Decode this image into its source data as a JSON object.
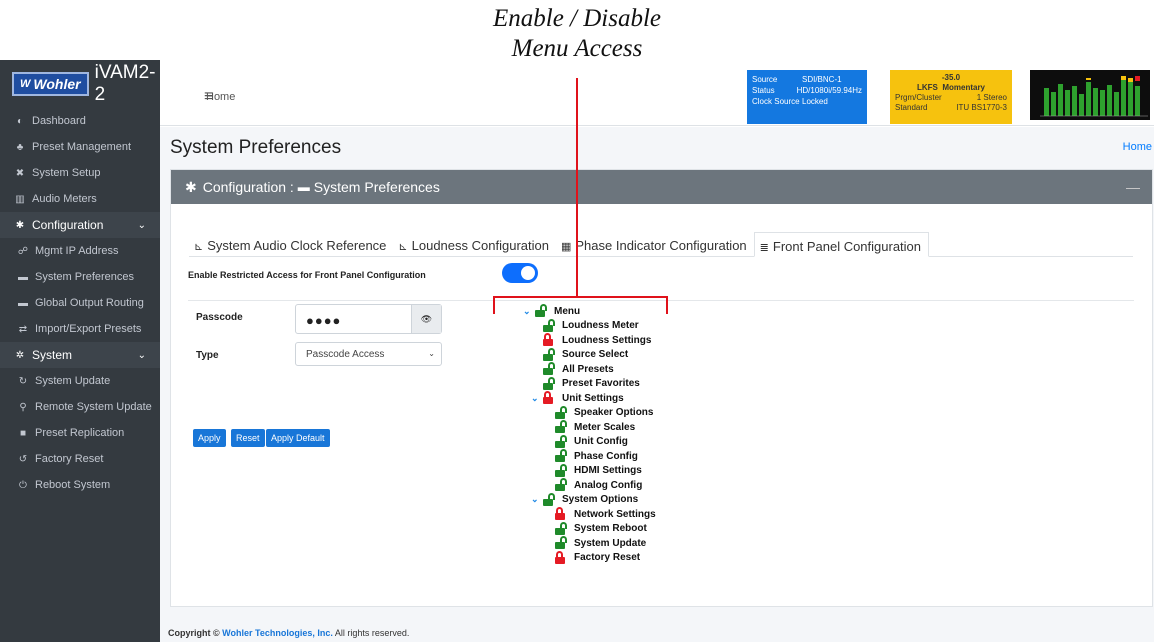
{
  "annotation": {
    "line1": "Enable / Disable",
    "line2": "Menu Access"
  },
  "brand": {
    "logo": "Wohler",
    "product": "iVAM2-2"
  },
  "sidebar": {
    "items": [
      {
        "label": "Dashboard",
        "icon": "dashboard-icon",
        "glyph": "◐"
      },
      {
        "label": "Preset Management",
        "icon": "users-icon",
        "glyph": "♣"
      },
      {
        "label": "System Setup",
        "icon": "tools-icon",
        "glyph": "✖"
      },
      {
        "label": "Audio Meters",
        "icon": "chart-icon",
        "glyph": "▥"
      },
      {
        "label": "Configuration",
        "icon": "gear-icon",
        "glyph": "✱",
        "group": true
      },
      {
        "label": "Mgmt IP Address",
        "icon": "network-icon",
        "glyph": "☍"
      },
      {
        "label": "System Preferences",
        "icon": "card-icon",
        "glyph": "▬"
      },
      {
        "label": "Global Output Routing",
        "icon": "card-icon",
        "glyph": "▬"
      },
      {
        "label": "Import/Export Presets",
        "icon": "exchange-icon",
        "glyph": "⇄"
      },
      {
        "label": "System",
        "icon": "cogs-icon",
        "glyph": "✲",
        "group": true
      },
      {
        "label": "System Update",
        "icon": "sync-icon",
        "glyph": "↻"
      },
      {
        "label": "Remote System Update",
        "icon": "satellite-icon",
        "glyph": "⚲"
      },
      {
        "label": "Preset Replication",
        "icon": "copy-icon",
        "glyph": "■"
      },
      {
        "label": "Factory Reset",
        "icon": "undo-icon",
        "glyph": "↺"
      },
      {
        "label": "Reboot System",
        "icon": "power-icon",
        "glyph": "⏻"
      }
    ]
  },
  "topbar": {
    "home": "Home"
  },
  "status": {
    "rows": [
      [
        "Source",
        "SDI/BNC-1"
      ],
      [
        "Status",
        "HD/1080i/59.94Hz"
      ],
      [
        "Clock Source",
        "Locked"
      ]
    ]
  },
  "lkfs": {
    "value": "-35.0",
    "lkfs": "LKFS",
    "mode": "Momentary",
    "prgm_label": "Prgm/Cluster",
    "prgm_value": "1  Stereo",
    "std_label": "Standard",
    "std_value": "ITU BS1770-3"
  },
  "page": {
    "title": "System Preferences",
    "breadcrumb": "Home"
  },
  "card": {
    "title": "Configuration : ",
    "subtitle": "System Preferences"
  },
  "tabs": [
    {
      "label": "System Audio Clock Reference",
      "glyph": "⊾"
    },
    {
      "label": "Loudness Configuration",
      "glyph": "⊾"
    },
    {
      "label": "Phase Indicator Configuration",
      "glyph": "▦"
    },
    {
      "label": "Front Panel Configuration",
      "glyph": "≣",
      "active": true
    }
  ],
  "form": {
    "enable_label": "Enable Restricted Access for Front Panel Configuration",
    "enabled": true,
    "passcode_label": "Passcode",
    "passcode_value": "●●●●",
    "type_label": "Type",
    "type_value": "Passcode Access",
    "buttons": {
      "apply": "Apply",
      "reset": "Reset",
      "apply_default": "Apply Default"
    }
  },
  "tree": [
    {
      "label": "Menu",
      "locked": false,
      "level": 0,
      "expand": true
    },
    {
      "label": "Loudness Meter",
      "locked": false,
      "level": 1
    },
    {
      "label": "Loudness Settings",
      "locked": true,
      "level": 1
    },
    {
      "label": "Source Select",
      "locked": false,
      "level": 1
    },
    {
      "label": "All Presets",
      "locked": false,
      "level": 1
    },
    {
      "label": "Preset Favorites",
      "locked": false,
      "level": 1
    },
    {
      "label": "Unit Settings",
      "locked": true,
      "level": 1,
      "expand": true
    },
    {
      "label": "Speaker Options",
      "locked": false,
      "level": 2
    },
    {
      "label": "Meter Scales",
      "locked": false,
      "level": 2
    },
    {
      "label": "Unit Config",
      "locked": false,
      "level": 2
    },
    {
      "label": "Phase Config",
      "locked": false,
      "level": 2
    },
    {
      "label": "HDMI Settings",
      "locked": false,
      "level": 2
    },
    {
      "label": "Analog Config",
      "locked": false,
      "level": 2
    },
    {
      "label": "System Options",
      "locked": false,
      "level": 1,
      "expand": true
    },
    {
      "label": "Network Settings",
      "locked": true,
      "level": 2
    },
    {
      "label": "System Reboot",
      "locked": false,
      "level": 2
    },
    {
      "label": "System Update",
      "locked": false,
      "level": 2
    },
    {
      "label": "Factory Reset",
      "locked": true,
      "level": 2
    }
  ],
  "footer": {
    "prefix": "Copyright ©",
    "company": "Wohler Technologies, Inc.",
    "suffix": "All rights reserved."
  },
  "colors": {
    "accent": "#1876d8",
    "annotation": "#e0121b",
    "sidebar": "#343a40",
    "lkfs": "#f6c20e",
    "status": "#1478e0"
  }
}
